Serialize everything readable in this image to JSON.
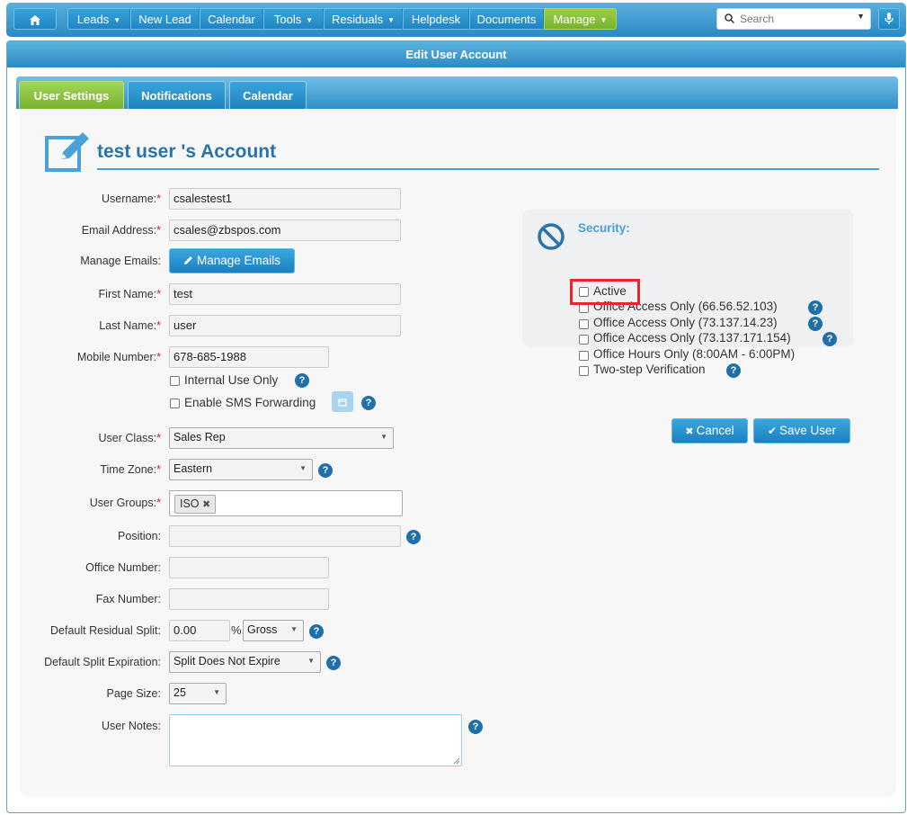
{
  "nav": {
    "items": [
      {
        "label": "Leads",
        "caret": true
      },
      {
        "label": "New Lead",
        "caret": false
      },
      {
        "label": "Calendar",
        "caret": false
      },
      {
        "label": "Tools",
        "caret": true
      },
      {
        "label": "Residuals",
        "caret": true
      },
      {
        "label": "Helpdesk",
        "caret": false
      },
      {
        "label": "Documents",
        "caret": false
      },
      {
        "label": "Manage",
        "caret": true
      }
    ],
    "search_placeholder": "Search"
  },
  "panel": {
    "title": "Edit User Account",
    "tabs": [
      "User Settings",
      "Notifications",
      "Calendar"
    ],
    "active_tab": "User Settings"
  },
  "account": {
    "title": "test user 's Account"
  },
  "form": {
    "username": {
      "label": "Username:",
      "value": "csalestest1"
    },
    "email": {
      "label": "Email Address:",
      "value": "csales@zbspos.com"
    },
    "manage_emails": {
      "label": "Manage Emails:",
      "button": "Manage Emails"
    },
    "first_name": {
      "label": "First Name:",
      "value": "test"
    },
    "last_name": {
      "label": "Last Name:",
      "value": "user"
    },
    "mobile": {
      "label": "Mobile Number:",
      "value": "678-685-1988"
    },
    "internal_use": {
      "label": "Internal Use Only",
      "checked": false
    },
    "sms_forwarding": {
      "label": "Enable SMS Forwarding",
      "checked": false
    },
    "user_class": {
      "label": "User Class:",
      "value": "Sales Rep"
    },
    "time_zone": {
      "label": "Time Zone:",
      "value": "Eastern"
    },
    "user_groups": {
      "label": "User Groups:",
      "tags": [
        "ISO"
      ]
    },
    "position": {
      "label": "Position:",
      "value": ""
    },
    "office_number": {
      "label": "Office Number:",
      "value": ""
    },
    "fax_number": {
      "label": "Fax Number:",
      "value": ""
    },
    "residual_split": {
      "label": "Default Residual Split:",
      "value": "0.00",
      "unit": "%",
      "type": "Gross"
    },
    "split_expiration": {
      "label": "Default Split Expiration:",
      "value": "Split Does Not Expire"
    },
    "page_size": {
      "label": "Page Size:",
      "value": "25"
    },
    "user_notes": {
      "label": "User Notes:",
      "value": ""
    }
  },
  "security": {
    "title": "Security:",
    "options": [
      {
        "label": "Active",
        "checked": false
      },
      {
        "label": "Office Access Only (66.56.52.103)",
        "checked": false,
        "help": true
      },
      {
        "label": "Office Access Only (73.137.14.23)",
        "checked": false,
        "help": true
      },
      {
        "label": "Office Access Only (73.137.171.154)",
        "checked": false,
        "help": true
      },
      {
        "label": "Office Hours Only (8:00AM - 6:00PM)",
        "checked": false,
        "help": false
      },
      {
        "label": "Two-step Verification",
        "checked": false,
        "help": true
      }
    ]
  },
  "actions": {
    "cancel": "Cancel",
    "save": "Save User"
  },
  "colors": {
    "nav_blue": "#2b8ac4",
    "active_green": "#77b32d",
    "title_blue": "#2a73a8",
    "highlight_red": "#e8262b"
  }
}
